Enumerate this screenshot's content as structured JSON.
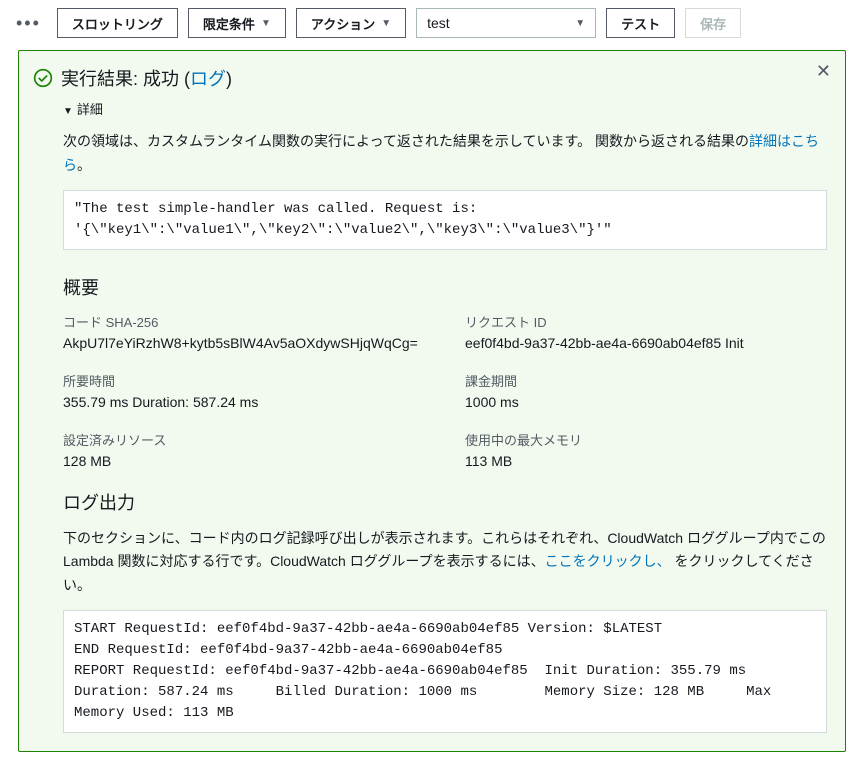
{
  "toolbar": {
    "throttling_label": "スロットリング",
    "qualifiers_label": "限定条件",
    "actions_label": "アクション",
    "test_event_selected": "test",
    "test_button_label": "テスト",
    "save_button_label": "保存"
  },
  "result": {
    "title_prefix": "実行結果: 成功 (",
    "log_link": "ログ",
    "title_suffix": ")",
    "details_label": "詳細",
    "summary_text_prefix": "次の領域は、カスタムランタイム関数の実行によって返された結果を示しています。 関数から返される結果の",
    "summary_link": "詳細はこちら",
    "summary_text_suffix": "。",
    "output": "\"The test simple-handler was called. Request is: '{\\\"key1\\\":\\\"value1\\\",\\\"key2\\\":\\\"value2\\\",\\\"key3\\\":\\\"value3\\\"}'\""
  },
  "overview": {
    "heading": "概要",
    "sha_label": "コード SHA-256",
    "sha_value": "AkpU7l7eYiRzhW8+kytb5sBlW4Av5aOXdywSHjqWqCg=",
    "request_id_label": "リクエスト ID",
    "request_id_value": "eef0f4bd-9a37-42bb-ae4a-6690ab04ef85 Init",
    "duration_label": "所要時間",
    "duration_value": "355.79 ms Duration: 587.24 ms",
    "billed_label": "課金期間",
    "billed_value": "1000 ms",
    "resources_label": "設定済みリソース",
    "resources_value": "128 MB",
    "max_mem_label": "使用中の最大メモリ",
    "max_mem_value": "113 MB"
  },
  "log": {
    "heading": "ログ出力",
    "desc_prefix": "下のセクションに、コード内のログ記録呼び出しが表示されます。これらはそれぞれ、CloudWatch ロググループ内でこの Lambda 関数に対応する行です。CloudWatch ロググループを表示するには、",
    "desc_link": "ここをクリックし、",
    "desc_suffix": " をクリックしてください。",
    "content": "START RequestId: eef0f4bd-9a37-42bb-ae4a-6690ab04ef85 Version: $LATEST\nEND RequestId: eef0f4bd-9a37-42bb-ae4a-6690ab04ef85\nREPORT RequestId: eef0f4bd-9a37-42bb-ae4a-6690ab04ef85\tInit Duration: 355.79 ms\tDuration: 587.24 ms\tBilled Duration: 1000 ms \tMemory Size: 128 MB\tMax Memory Used: 113 MB"
  }
}
